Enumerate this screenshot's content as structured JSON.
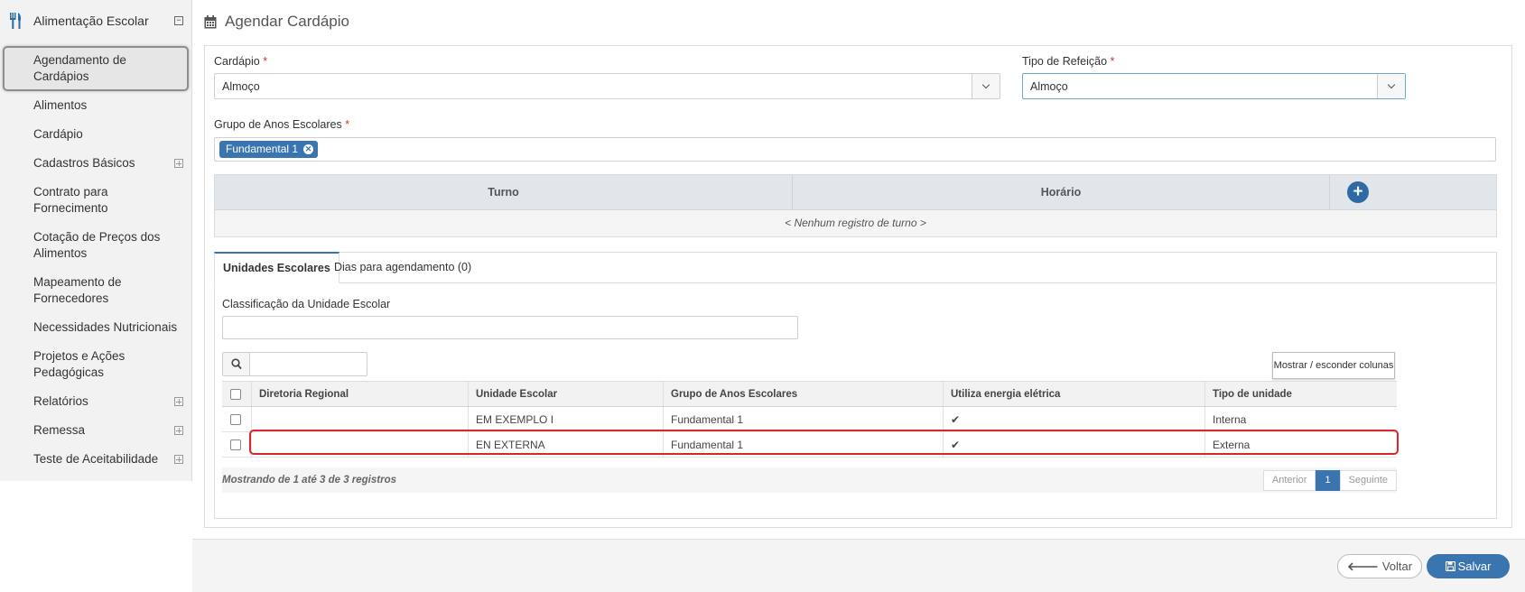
{
  "sidebar": {
    "title": "Alimentação Escolar",
    "collapse_symbol": "⊟",
    "items": [
      {
        "label": "Agendamento de Cardápios",
        "lines": [
          "Agendamento de",
          "Cardápios"
        ],
        "active": true
      },
      {
        "label": "Alimentos"
      },
      {
        "label": "Cardápio"
      },
      {
        "label": "Cadastros Básicos",
        "expandable": true
      },
      {
        "label": "Contrato para Fornecimento",
        "lines": [
          "Contrato para",
          "Fornecimento"
        ]
      },
      {
        "label": "Cotação de Preços dos Alimentos",
        "lines": [
          "Cotação de Preços dos",
          "Alimentos"
        ]
      },
      {
        "label": "Mapeamento de Fornecedores",
        "lines": [
          "Mapeamento de",
          "Fornecedores"
        ]
      },
      {
        "label": "Necessidades Nutricionais"
      },
      {
        "label": "Projetos e Ações Pedagógicas",
        "lines": [
          "Projetos e Ações",
          "Pedagógicas"
        ]
      },
      {
        "label": "Relatórios",
        "expandable": true
      },
      {
        "label": "Remessa",
        "expandable": true
      },
      {
        "label": "Teste de Aceitabilidade",
        "expandable": true
      }
    ]
  },
  "page": {
    "title": "Agendar Cardápio"
  },
  "form": {
    "cardapio_label": "Cardápio",
    "cardapio_value": "Almoço",
    "tipo_label": "Tipo de Refeição",
    "tipo_value": "Almoço",
    "grupo_label": "Grupo de Anos Escolares",
    "grupo_tag": "Fundamental 1",
    "required_mark": "*"
  },
  "turno_table": {
    "headers": [
      "Turno",
      "Horário"
    ],
    "add_symbol": "+",
    "empty_text": "< Nenhum registro de turno >"
  },
  "tabs": [
    {
      "label": "Unidades Escolares",
      "active": true
    },
    {
      "label": "Dias para agendamento (0)",
      "active": false
    }
  ],
  "unidades": {
    "classificacao_label": "Classificação da Unidade Escolar",
    "classificacao_value": "",
    "search_value": "",
    "columns_button": "Mostrar / esconder colunas",
    "headers": [
      "Diretoria Regional",
      "Unidade Escolar",
      "Grupo de Anos Escolares",
      "Utiliza energia elétrica",
      "Tipo de unidade"
    ],
    "rows": [
      {
        "diretoria": "",
        "unidade": "EM EXEMPLO I",
        "grupo": "Fundamental 1",
        "energia": "✔",
        "tipo": "Interna"
      },
      {
        "diretoria": "",
        "unidade": "EN EXTERNA",
        "grupo": "Fundamental 1",
        "energia": "✔",
        "tipo": "Externa",
        "highlighted": true
      }
    ],
    "info": "Mostrando de 1 até 3 de 3 registros",
    "pager": {
      "prev": "Anterior",
      "current": "1",
      "next": "Seguinte"
    }
  },
  "actions": {
    "back_label": "Voltar",
    "back_icon": "arrow-left-icon",
    "save_label": "Salvar",
    "save_icon": "floppy-disk-icon"
  },
  "colors": {
    "accent": "#3a75b0",
    "highlight_border": "#d9262c",
    "check": "#3d8a3d"
  }
}
